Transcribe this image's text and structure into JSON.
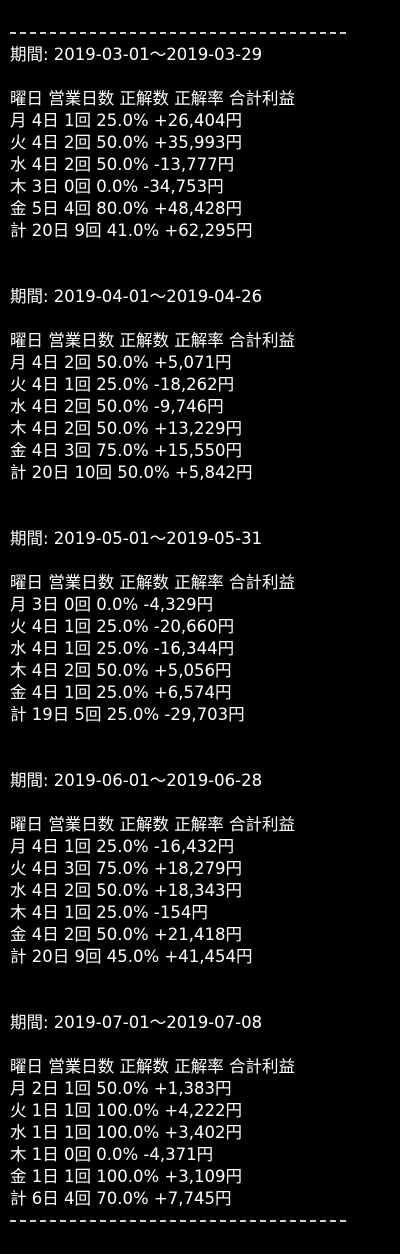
{
  "separator": "----------------------------------------------------",
  "sections": [
    {
      "period": "期間: 2019-03-01〜2019-03-29",
      "header": "曜日 営業日数 正解数 正解率 合計利益",
      "rows": [
        "月 4日 1回 25.0% +26,404円",
        "火 4日 2回 50.0% +35,993円",
        "水 4日 2回 50.0% -13,777円",
        "木 3日 0回 0.0% -34,753円",
        "金 5日 4回 80.0% +48,428円",
        "計 20日 9回 41.0% +62,295円"
      ]
    },
    {
      "period": "期間: 2019-04-01〜2019-04-26",
      "header": "曜日 営業日数 正解数 正解率 合計利益",
      "rows": [
        "月 4日 2回 50.0% +5,071円",
        "火 4日 1回 25.0% -18,262円",
        "水 4日 2回 50.0% -9,746円",
        "木 4日 2回 50.0% +13,229円",
        "金 4日 3回 75.0% +15,550円",
        "計 20日 10回 50.0% +5,842円"
      ]
    },
    {
      "period": "期間: 2019-05-01〜2019-05-31",
      "header": "曜日 営業日数 正解数 正解率 合計利益",
      "rows": [
        "月 3日 0回 0.0% -4,329円",
        "火 4日 1回 25.0% -20,660円",
        "水 4日 1回 25.0% -16,344円",
        "木 4日 2回 50.0% +5,056円",
        "金 4日 1回 25.0% +6,574円",
        "計 19日 5回 25.0% -29,703円"
      ]
    },
    {
      "period": "期間: 2019-06-01〜2019-06-28",
      "header": "曜日 営業日数 正解数 正解率 合計利益",
      "rows": [
        "月 4日 1回 25.0% -16,432円",
        "火 4日 3回 75.0% +18,279円",
        "水 4日 2回 50.0% +18,343円",
        "木 4日 1回 25.0% -154円",
        "金 4日 2回 50.0% +21,418円",
        "計 20日 9回 45.0% +41,454円"
      ]
    },
    {
      "period": "期間: 2019-07-01〜2019-07-08",
      "header": "曜日 営業日数 正解数 正解率 合計利益",
      "rows": [
        "月 2日 1回 50.0% +1,383円",
        "火 1日 1回 100.0% +4,222円",
        "水 1日 1回 100.0% +3,402円",
        "木 1日 0回 0.0% -4,371円",
        "金 1日 1回 100.0% +3,109円",
        "計 6日 4回 70.0% +7,745円"
      ]
    }
  ]
}
